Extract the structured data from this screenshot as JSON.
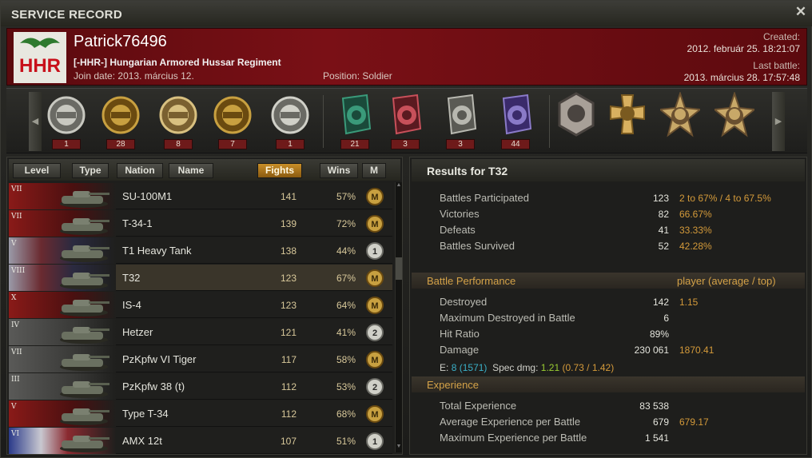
{
  "window": {
    "title": "SERVICE RECORD",
    "close_glyph": "✕"
  },
  "player": {
    "name": "Patrick76496",
    "clan_tag": "[-HHR-]",
    "clan_name": "Hungarian Armored Hussar Regiment",
    "clan_logo_text": "HHR",
    "join_label": "Join date:",
    "join_date": "2013. március 12.",
    "position_label": "Position:",
    "position": "Soldier",
    "created_label": "Created:",
    "created": "2012. február 25. 18:21:07",
    "last_battle_label": "Last battle:",
    "last_battle": "2013. március 28. 17:57:48"
  },
  "medals": [
    {
      "icon": "top-gun-medal-icon",
      "count": "1"
    },
    {
      "icon": "sniper-medal-icon",
      "count": "28"
    },
    {
      "icon": "invader-medal-icon",
      "count": "8"
    },
    {
      "icon": "defender-medal-icon",
      "count": "7"
    },
    {
      "icon": "steel-wall-medal-icon",
      "count": "1"
    },
    {
      "icon": "scout-medal-icon",
      "count": "21"
    },
    {
      "icon": "patrol-duty-medal-icon",
      "count": "3"
    },
    {
      "icon": "confederate-medal-icon",
      "count": "3"
    },
    {
      "icon": "brothers-in-arms-medal-icon",
      "count": "44"
    },
    {
      "icon": "hero-medal-icon",
      "count": ""
    },
    {
      "icon": "cross-medal-icon",
      "count": ""
    },
    {
      "icon": "star-medal-icon",
      "count": ""
    },
    {
      "icon": "star-medal-icon-2",
      "count": ""
    }
  ],
  "sort_buttons": {
    "level": "Level",
    "type": "Type",
    "nation": "Nation",
    "name": "Name",
    "fights": "Fights",
    "wins": "Wins",
    "mastery": "M"
  },
  "vehicles": [
    {
      "tier": "VII",
      "nation": "ussr",
      "name": "SU-100M1",
      "fights": "141",
      "wins": "57%",
      "mastery": "M"
    },
    {
      "tier": "VII",
      "nation": "ussr",
      "name": "T-34-1",
      "fights": "139",
      "wins": "72%",
      "mastery": "M"
    },
    {
      "tier": "V",
      "nation": "usa",
      "name": "T1 Heavy Tank",
      "fights": "138",
      "wins": "44%",
      "mastery": "1"
    },
    {
      "tier": "VIII",
      "nation": "usa",
      "name": "T32",
      "fights": "123",
      "wins": "67%",
      "mastery": "M"
    },
    {
      "tier": "X",
      "nation": "ussr",
      "name": "IS-4",
      "fights": "123",
      "wins": "64%",
      "mastery": "M"
    },
    {
      "tier": "IV",
      "nation": "germany",
      "name": "Hetzer",
      "fights": "121",
      "wins": "41%",
      "mastery": "2"
    },
    {
      "tier": "VII",
      "nation": "germany",
      "name": "PzKpfw VI Tiger",
      "fights": "117",
      "wins": "58%",
      "mastery": "M"
    },
    {
      "tier": "III",
      "nation": "germany",
      "name": "PzKpfw 38 (t)",
      "fights": "112",
      "wins": "53%",
      "mastery": "2"
    },
    {
      "tier": "V",
      "nation": "ussr",
      "name": "Type T-34",
      "fights": "112",
      "wins": "68%",
      "mastery": "M"
    },
    {
      "tier": "VI",
      "nation": "france",
      "name": "AMX 12t",
      "fights": "107",
      "wins": "51%",
      "mastery": "1"
    }
  ],
  "results": {
    "header": "Results for T32",
    "general": [
      {
        "label": "Battles Participated",
        "value": "123",
        "extra": "2 to 67% / 4 to 67.5%"
      },
      {
        "label": "Victories",
        "value": "82",
        "extra": "66.67%"
      },
      {
        "label": "Defeats",
        "value": "41",
        "extra": "33.33%"
      },
      {
        "label": "Battles Survived",
        "value": "52",
        "extra": "42.28%"
      }
    ],
    "performance_title": "Battle Performance",
    "performance_right": "player (average / top)",
    "performance": [
      {
        "label": "Destroyed",
        "value": "142",
        "extra": "1.15"
      },
      {
        "label": "Maximum Destroyed in Battle",
        "value": "6",
        "extra": ""
      },
      {
        "label": "Hit Ratio",
        "value": "89%",
        "extra": ""
      },
      {
        "label": "Damage",
        "value": "230 061",
        "extra": "1870.41"
      }
    ],
    "efficiency": {
      "e_label": "E:",
      "e_value": "8",
      "e_paren": "(1571)",
      "spec_label": "Spec dmg:",
      "spec_value": "1.21",
      "spec_paren": "(0.73 / 1.42)"
    },
    "experience_title": "Experience",
    "experience": [
      {
        "label": "Total Experience",
        "value": "83 538",
        "extra": ""
      },
      {
        "label": "Average Experience per Battle",
        "value": "679",
        "extra": "679.17"
      },
      {
        "label": "Maximum Experience per Battle",
        "value": "1 541",
        "extra": ""
      }
    ]
  },
  "colors": {
    "header_red": "#7a1016",
    "accent_gold": "#d4a248",
    "active_button": "#c88e28",
    "efficiency_cyan": "#3ab0c8",
    "efficiency_green": "#9acd32"
  }
}
